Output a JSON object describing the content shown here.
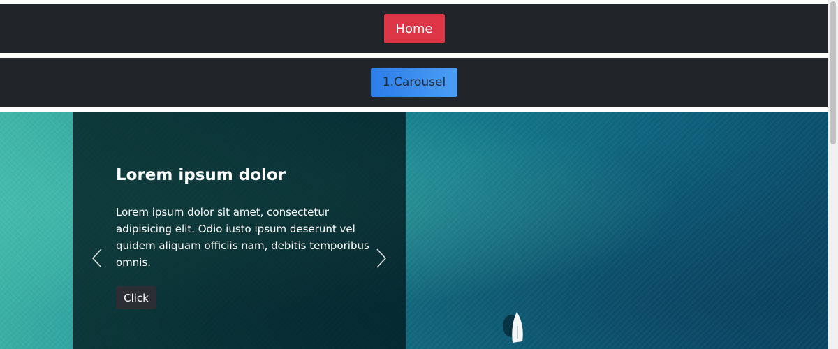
{
  "nav": {
    "home_label": "Home",
    "carousel_label": "1.Carousel"
  },
  "carousel": {
    "slide": {
      "title": "Lorem ipsum dolor",
      "text": "Lorem ipsum dolor sit amet, consectetur adipisicing elit. Odio iusto ipsum deserunt vel quidem aliquam officiis nam, debitis temporibus omnis.",
      "button_label": "Click"
    },
    "controls": {
      "prev_icon": "chevron-left-icon",
      "next_icon": "chevron-right-icon"
    }
  },
  "colors": {
    "nav_bg": "#212529",
    "home_button": "#dc3545",
    "carousel_button": "#2b7de9",
    "caption_overlay": "#02181c",
    "sea": "#14788a"
  }
}
